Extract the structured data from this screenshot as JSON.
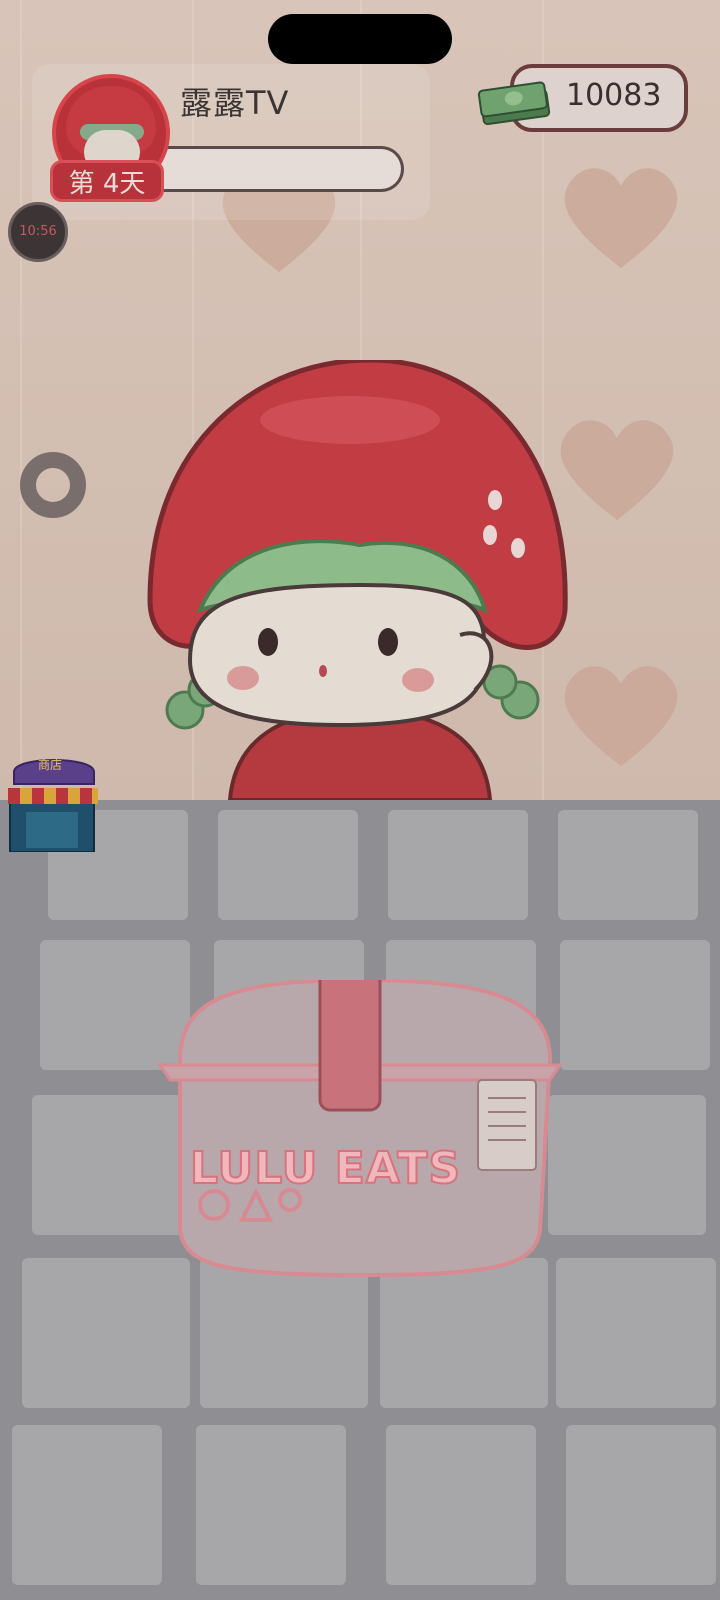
{
  "player": {
    "name": "露露TV",
    "day_badge": "第 4天"
  },
  "currency": {
    "money": "10083",
    "icon": "cash-stack-icon"
  },
  "timer": {
    "label": "10:56"
  },
  "shop": {
    "label": "商店"
  },
  "lunchbox": {
    "brand_text": "LULU EATS"
  },
  "colors": {
    "accent_red": "#c63a42",
    "hair_green": "#86a98a",
    "money_border": "#6a3c3e"
  }
}
